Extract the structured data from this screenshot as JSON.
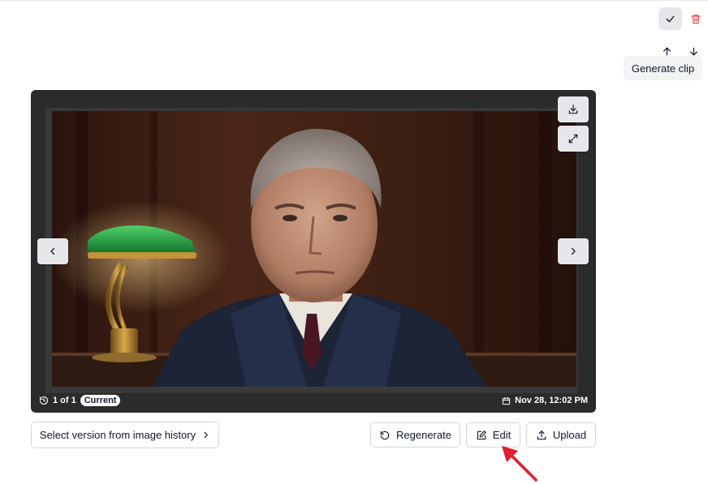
{
  "toolbar": {
    "confirm_icon": "check-icon",
    "delete_icon": "trash-icon",
    "delete_color": "#ef4444",
    "move_up_icon": "arrow-up-icon",
    "move_down_icon": "arrow-down-icon",
    "tooltip": "Generate clip"
  },
  "viewer": {
    "download_icon": "download-icon",
    "fullscreen_icon": "expand-icon",
    "prev_icon": "chevron-left-icon",
    "next_icon": "chevron-right-icon",
    "counter": "1 of 1",
    "badge": "Current",
    "date": "Nov 28, 12:02 PM"
  },
  "actions": {
    "history_label": "Select version from image history",
    "regenerate_label": "Regenerate",
    "edit_label": "Edit",
    "upload_label": "Upload",
    "annotation_color": "#e11d2e"
  }
}
